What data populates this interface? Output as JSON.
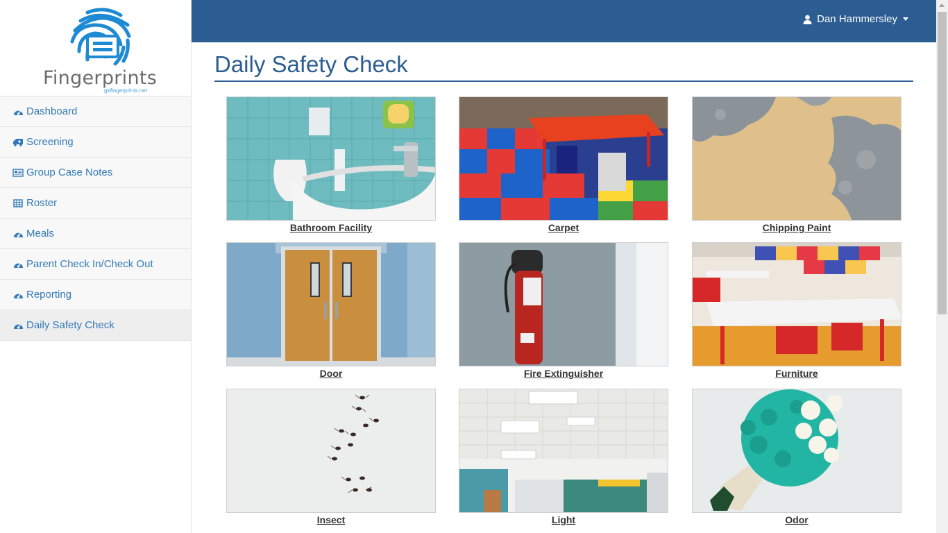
{
  "app": {
    "logo_text": "Fingerprints",
    "logo_sub": "gefingerprints.net",
    "brand_color": "#2c5d92",
    "logo_color": "#1e8ad3"
  },
  "header": {
    "user_name": "Dan Hammersley",
    "user_icon": "user-icon"
  },
  "sidebar": {
    "items": [
      {
        "label": "Dashboard",
        "icon": "dashboard-icon"
      },
      {
        "label": "Screening",
        "icon": "ambulance-icon"
      },
      {
        "label": "Group Case Notes",
        "icon": "newspaper-icon"
      },
      {
        "label": "Roster",
        "icon": "table-icon"
      },
      {
        "label": "Meals",
        "icon": "dashboard-icon"
      },
      {
        "label": "Parent Check In/Check Out",
        "icon": "dashboard-icon"
      },
      {
        "label": "Reporting",
        "icon": "dashboard-icon"
      },
      {
        "label": "Daily Safety Check",
        "icon": "dashboard-icon",
        "active": true
      }
    ]
  },
  "main": {
    "title": "Daily Safety Check",
    "items": [
      {
        "label": "Bathroom Facility"
      },
      {
        "label": "Carpet"
      },
      {
        "label": "Chipping Paint"
      },
      {
        "label": "Door"
      },
      {
        "label": "Fire Extinguisher"
      },
      {
        "label": "Furniture"
      },
      {
        "label": "Insect"
      },
      {
        "label": "Light"
      },
      {
        "label": "Odor"
      }
    ]
  }
}
